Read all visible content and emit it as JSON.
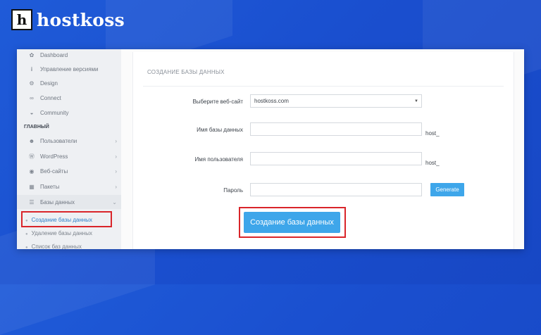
{
  "brand": {
    "logo_letter": "h",
    "name": "hostkoss"
  },
  "sidebar": {
    "top_items": [
      {
        "label": "Dashboard",
        "icon": "palette-icon"
      },
      {
        "label": "Управление версиями",
        "icon": "info-icon"
      },
      {
        "label": "Design",
        "icon": "gear-icon"
      },
      {
        "label": "Connect",
        "icon": "link-icon"
      },
      {
        "label": "Community",
        "icon": "chat-icon"
      }
    ],
    "section_title": "ГЛАВНЫЙ",
    "main_items": [
      {
        "label": "Пользователи",
        "icon": "users-icon",
        "chevron": "›"
      },
      {
        "label": "WordPress",
        "icon": "wordpress-icon",
        "chevron": "›"
      },
      {
        "label": "Веб-сайты",
        "icon": "globe-icon",
        "chevron": "›"
      },
      {
        "label": "Пакеты",
        "icon": "cubes-icon",
        "chevron": "›"
      },
      {
        "label": "Базы данных",
        "icon": "database-icon",
        "chevron": "⌄"
      }
    ],
    "sub_items": [
      {
        "label": "Создание базы данных",
        "active": true
      },
      {
        "label": "Удаление базы данных",
        "active": false
      },
      {
        "label": "Список баз данных",
        "active": false
      }
    ]
  },
  "form": {
    "title": "СОЗДАНИЕ БАЗЫ ДАННЫХ",
    "website_label": "Выберите веб-сайт",
    "website_value": "hostkoss.com",
    "dbname_label": "Имя базы данных",
    "dbname_value": "",
    "dbname_suffix": "host_",
    "username_label": "Имя пользователя",
    "username_value": "",
    "username_suffix": "host_",
    "password_label": "Пароль",
    "password_value": "",
    "generate_label": "Generate",
    "submit_label": "Создание базы данных"
  },
  "colors": {
    "accent": "#3ea6ea",
    "highlight": "#d9252a",
    "background": "#1f5bd8"
  }
}
